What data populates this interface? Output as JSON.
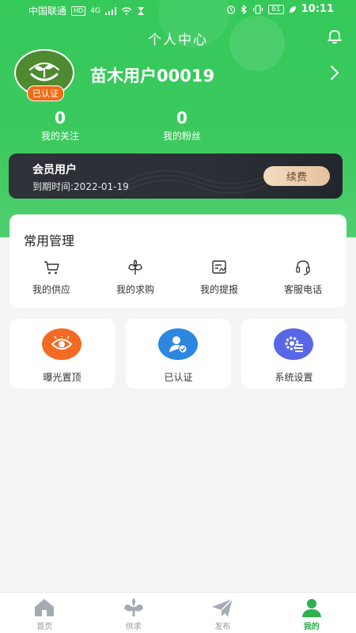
{
  "status_bar": {
    "carrier": "中国联通",
    "network_badge": "HD",
    "signal_text": "4G",
    "battery": "61",
    "time": "10:11"
  },
  "page_title": "个人中心",
  "profile": {
    "username": "苗木用户00019",
    "verified_badge": "已认证"
  },
  "stats": [
    {
      "value": "0",
      "label": "我的关注"
    },
    {
      "value": "0",
      "label": "我的粉丝"
    }
  ],
  "membership": {
    "title": "会员用户",
    "expiry": "到期时间:2022-01-19",
    "renew_label": "续费"
  },
  "management": {
    "heading": "常用管理",
    "items": [
      {
        "label": "我的供应",
        "icon": "cart-icon"
      },
      {
        "label": "我的求购",
        "icon": "sprout-icon"
      },
      {
        "label": "我的提报",
        "icon": "report-icon"
      },
      {
        "label": "客服电话",
        "icon": "headset-icon"
      }
    ]
  },
  "tiles": [
    {
      "label": "曝光置顶",
      "icon": "eye-icon",
      "color": "#f26a24"
    },
    {
      "label": "已认证",
      "icon": "verified-user-icon",
      "color": "#2d86e0"
    },
    {
      "label": "系统设置",
      "icon": "settings-icon",
      "color": "#5867e6"
    }
  ],
  "tabbar": [
    {
      "label": "首页",
      "icon": "home-icon",
      "active": false
    },
    {
      "label": "供求",
      "icon": "supply-icon",
      "active": false
    },
    {
      "label": "发布",
      "icon": "publish-icon",
      "active": false
    },
    {
      "label": "我的",
      "icon": "profile-icon",
      "active": true
    }
  ],
  "colors": {
    "primary_green": "#3cc95f",
    "active_tab": "#2eb04e",
    "member_card": "#2c2f36"
  }
}
